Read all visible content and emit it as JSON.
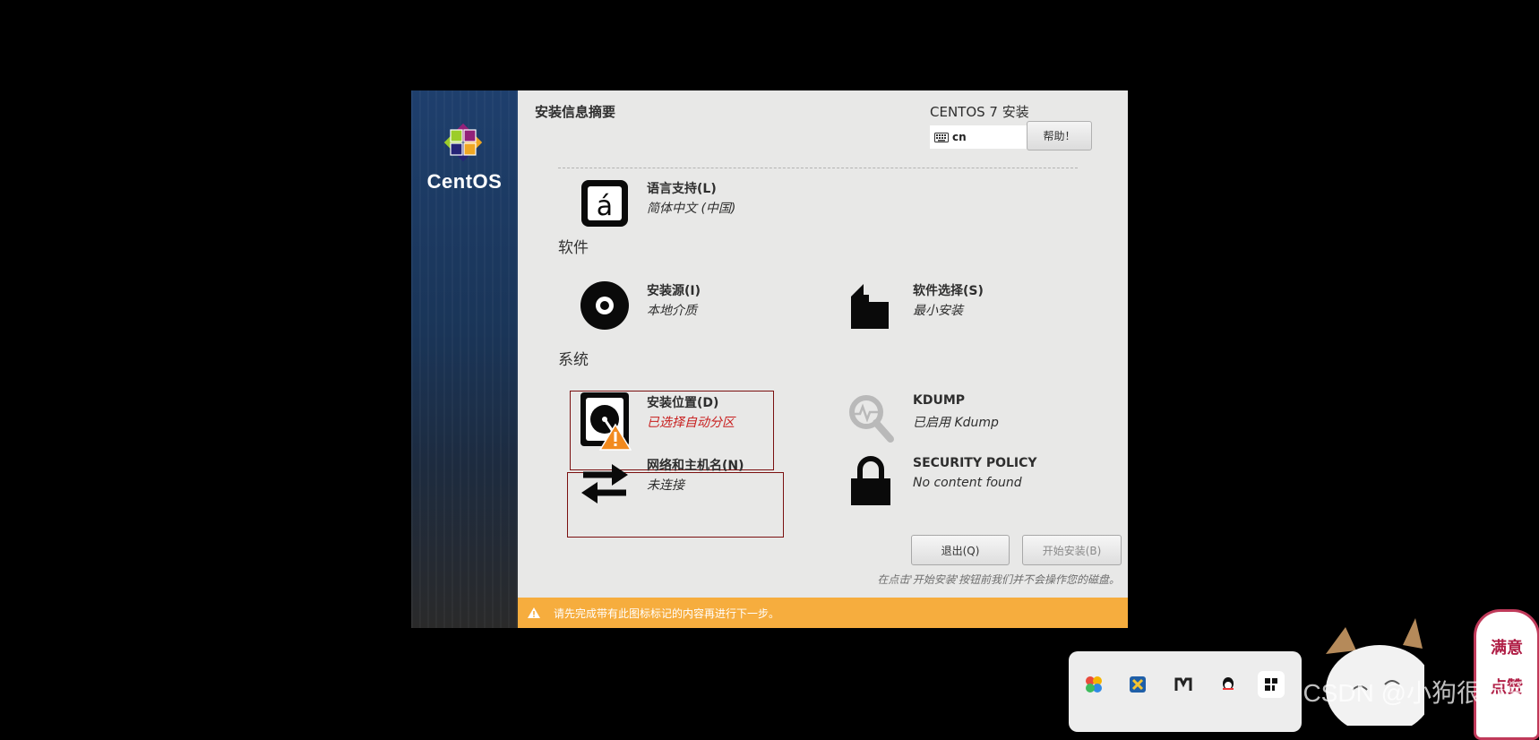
{
  "sidebar": {
    "brand": "CentOS"
  },
  "header": {
    "page_title": "安装信息摘要",
    "product_title": "CENTOS 7 安装",
    "keyboard_layout": "cn",
    "help_label": "帮助！"
  },
  "sections": {
    "software": "软件",
    "system": "系统"
  },
  "spokes": {
    "language": {
      "label": "语言支持(L)",
      "status": "简体中文 (中国)"
    },
    "source": {
      "label": "安装源(I)",
      "status": "本地介质"
    },
    "software_selection": {
      "label": "软件选择(S)",
      "status": "最小安装"
    },
    "destination": {
      "label": "安装位置(D)",
      "status": "已选择自动分区"
    },
    "kdump": {
      "label": "KDUMP",
      "status": "已启用 Kdump"
    },
    "network": {
      "label": "网络和主机名(N)",
      "status": "未连接"
    },
    "security": {
      "label": "SECURITY POLICY",
      "status": "No content found"
    }
  },
  "buttons": {
    "quit": "退出(Q)",
    "begin": "开始安装(B)"
  },
  "note": "在点击'开始安装'按钮前我们并不会操作您的磁盘。",
  "warning_bar": "请先完成带有此图标标记的内容再进行下一步。",
  "watermark": "CSDN @小狗很可爱",
  "sticker": [
    "满意",
    "点赞"
  ],
  "colors": {
    "warning": "#f6ad3e",
    "error_text": "#c81e1e",
    "highlight_box": "#7a1010"
  }
}
